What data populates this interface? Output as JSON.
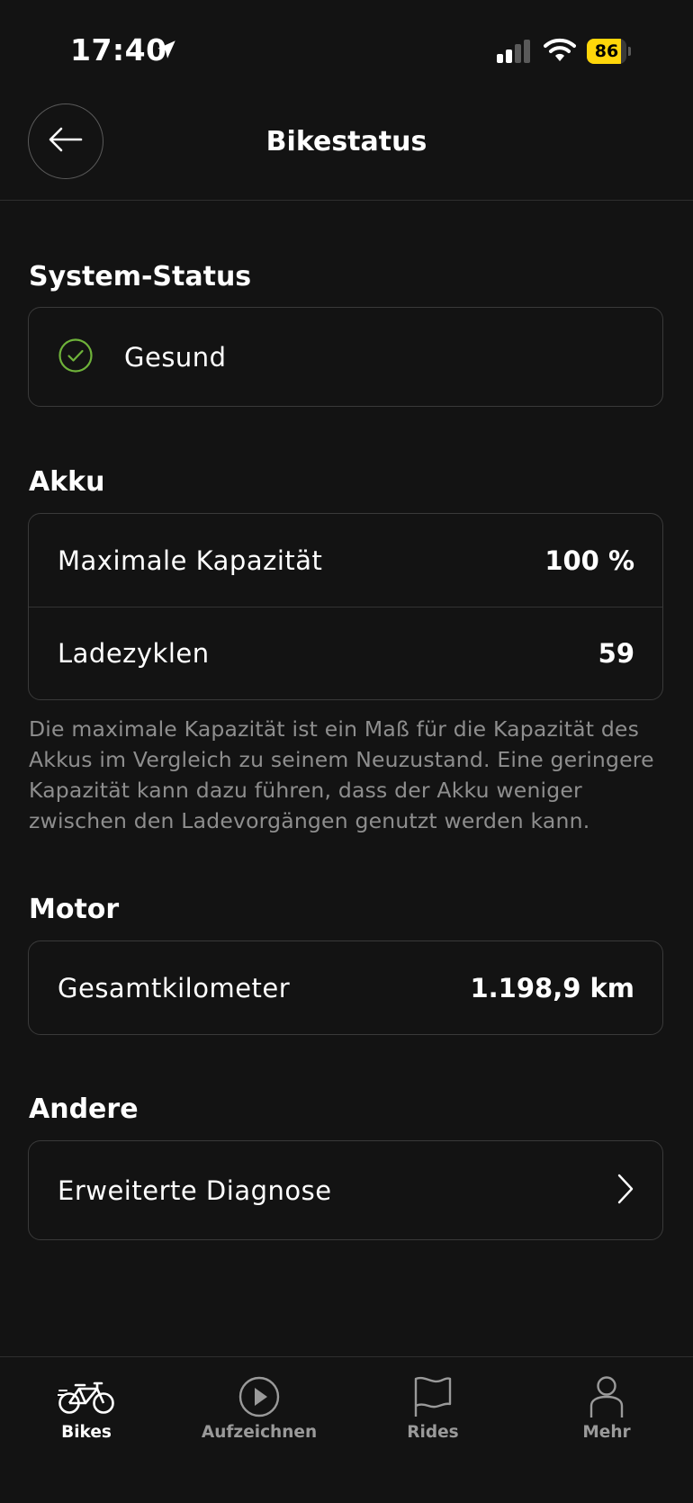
{
  "statusbar": {
    "time": "17:40",
    "battery_level": "86",
    "battery_fraction": 0.86,
    "battery_color": "#ffd60a"
  },
  "header": {
    "title": "Bikestatus",
    "back_icon": "arrow-left-icon"
  },
  "system_status": {
    "title": "System-Status",
    "status": "Gesund",
    "status_icon": "check-circle-icon",
    "status_color": "#6fb33a"
  },
  "battery": {
    "title": "Akku",
    "rows": [
      {
        "label": "Maximale Kapazität",
        "value": "100 %"
      },
      {
        "label": "Ladezyklen",
        "value": "59"
      }
    ],
    "note": "Die maximale Kapazität ist ein Maß für die Kapazität des Akkus im Vergleich zu seinem Neuzustand. Eine geringere Kapazität kann dazu führen, dass der Akku weniger zwischen den Ladevorgängen genutzt werden kann."
  },
  "motor": {
    "title": "Motor",
    "rows": [
      {
        "label": "Gesamtkilometer",
        "value": "1.198,9 km"
      }
    ]
  },
  "other": {
    "title": "Andere",
    "rows": [
      {
        "label": "Erweiterte Diagnose",
        "icon": "chevron-right-icon"
      }
    ]
  },
  "tabbar": {
    "tabs": [
      {
        "label": "Bikes",
        "icon": "bike-icon",
        "active": true
      },
      {
        "label": "Aufzeichnen",
        "icon": "play-circle-icon",
        "active": false
      },
      {
        "label": "Rides",
        "icon": "flag-icon",
        "active": false
      },
      {
        "label": "Mehr",
        "icon": "person-icon",
        "active": false
      }
    ]
  }
}
